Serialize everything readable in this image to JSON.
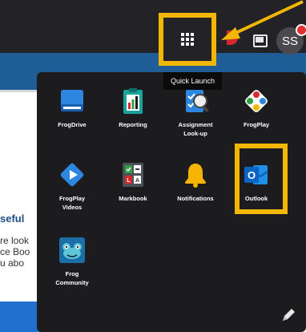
{
  "header": {
    "avatar_initials": "SS",
    "quick_launch_tooltip": "Quick Launch"
  },
  "background_page": {
    "heading_fragment": "seful",
    "text_fragments": [
      "re look",
      "ce Boo",
      "u abo"
    ]
  },
  "quick_launch": {
    "apps": [
      {
        "label": "FrogDrive",
        "icon": "drive-icon"
      },
      {
        "label": "Reporting",
        "icon": "reporting-icon"
      },
      {
        "label": "Assignment\nLook-up",
        "icon": "assignment-lookup-icon"
      },
      {
        "label": "FrogPlay",
        "icon": "frogplay-icon"
      },
      {
        "label": "FrogPlay\nVideos",
        "icon": "frogplay-videos-icon"
      },
      {
        "label": "Markbook",
        "icon": "markbook-icon"
      },
      {
        "label": "Notifications",
        "icon": "bell-icon"
      },
      {
        "label": "Outlook",
        "icon": "outlook-icon"
      },
      {
        "label": "Frog\nCommunity",
        "icon": "frog-community-icon"
      }
    ]
  },
  "colors": {
    "highlight": "#f2b705",
    "topbar": "#232327",
    "panel": "#1c1c1e",
    "brand_blue": "#1f5d96"
  }
}
